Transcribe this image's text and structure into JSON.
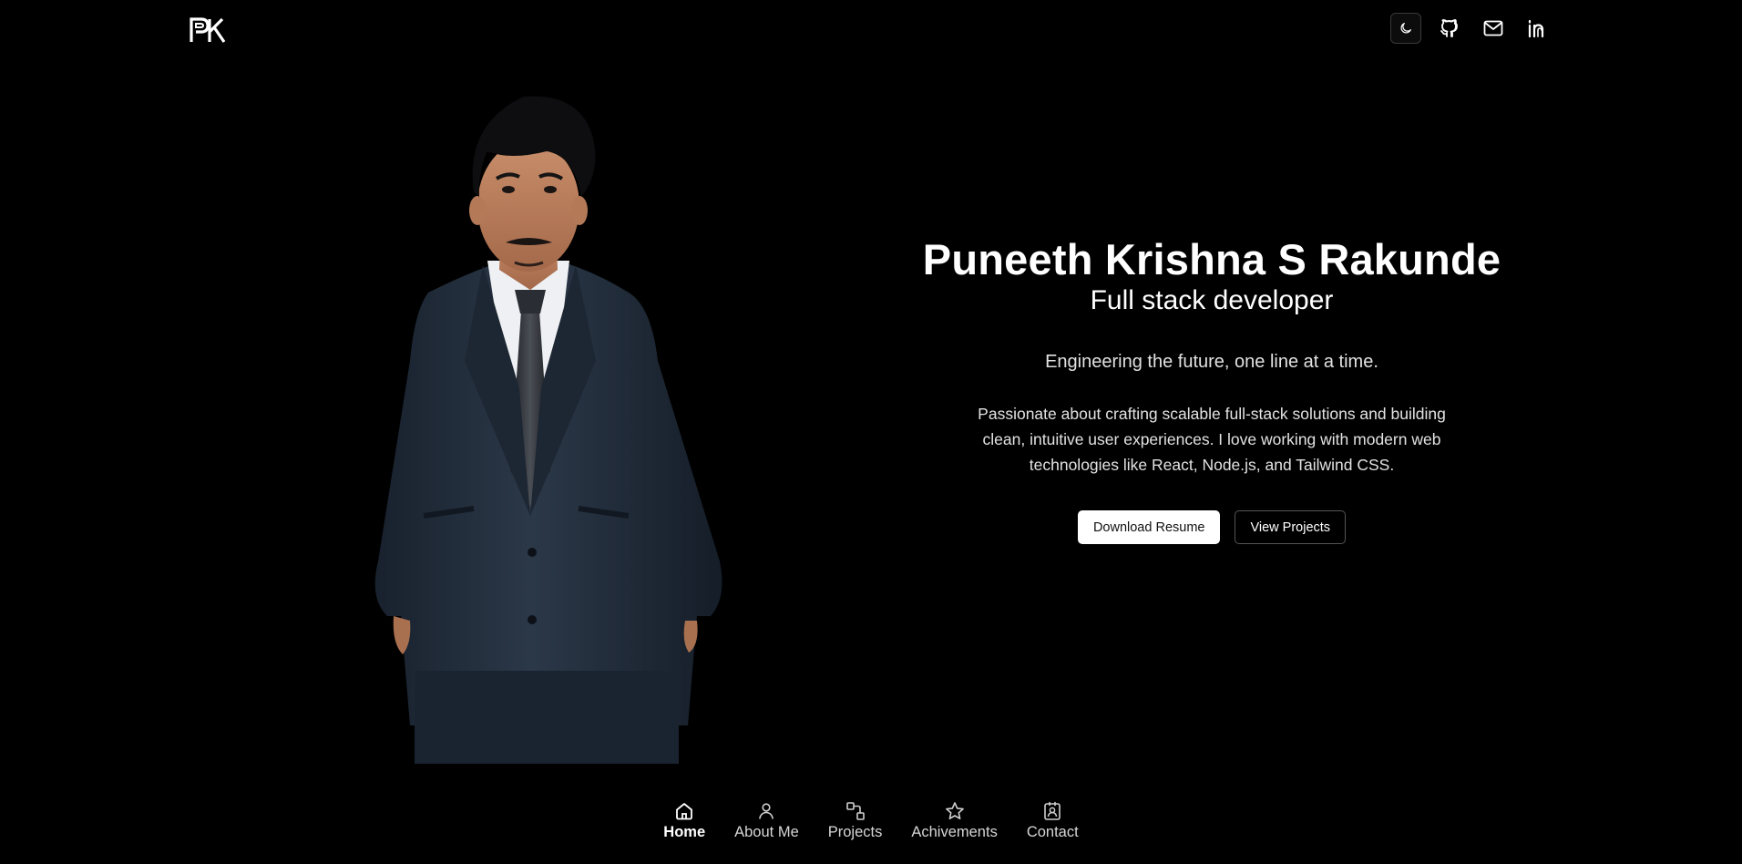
{
  "header": {
    "logo_text": "PK",
    "icons": [
      "moon-icon",
      "github-icon",
      "mail-icon",
      "linkedin-icon"
    ]
  },
  "hero": {
    "name": "Puneeth Krishna S Rakunde",
    "role": "Full stack developer",
    "tagline": "Engineering the future, one line at a time.",
    "bio": "Passionate about crafting scalable full-stack solutions and building clean, intuitive user experiences. I love working with modern web technologies like React, Node.js, and Tailwind CSS.",
    "buttons": {
      "resume": "Download Resume",
      "projects": "View Projects"
    }
  },
  "nav": {
    "items": [
      {
        "label": "Home",
        "icon": "home-icon",
        "active": true
      },
      {
        "label": "About Me",
        "icon": "user-icon",
        "active": false
      },
      {
        "label": "Projects",
        "icon": "projects-icon",
        "active": false
      },
      {
        "label": "Achivements",
        "icon": "star-icon",
        "active": false
      },
      {
        "label": "Contact",
        "icon": "contact-icon",
        "active": false
      }
    ]
  },
  "colors": {
    "background": "#000000",
    "text": "#ffffff",
    "muted": "#e2e2e2",
    "suit": "#1f2a38"
  }
}
